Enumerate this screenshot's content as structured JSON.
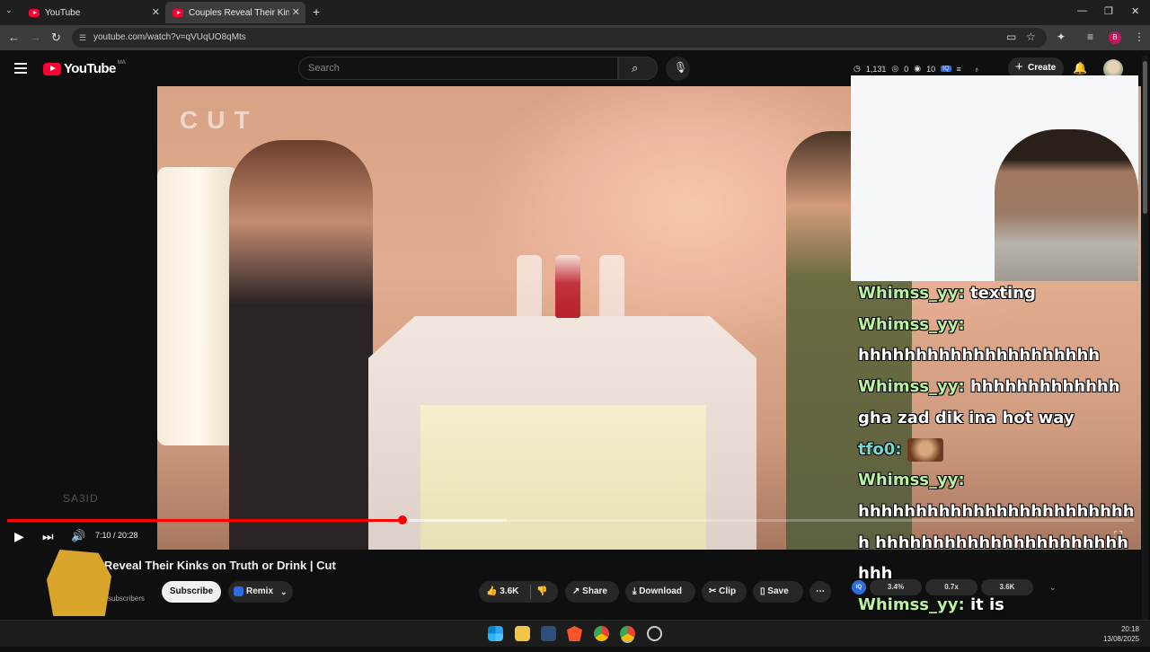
{
  "browser": {
    "tabs": [
      {
        "title": "YouTube",
        "active": false
      },
      {
        "title": "Couples Reveal Their Kinks on",
        "active": true
      }
    ],
    "url": "youtube.com/watch?v=qVUqUO8qMts",
    "profile_initial": "B"
  },
  "youtube": {
    "logo_text": "YouTube",
    "country_code": "MA",
    "search_placeholder": "Search",
    "header_stats": {
      "views": "1,131",
      "a": "0",
      "b": "10"
    },
    "create_label": "Create"
  },
  "video": {
    "brand_overlay": "CUT",
    "watermark": "SA3ID",
    "time": "7:10 / 20:28",
    "progress_fraction": 0.351
  },
  "chat": [
    {
      "user": "Whimss_yy:",
      "message": "texting",
      "color": "#b9f2a1"
    },
    {
      "user": "Whimss_yy:",
      "message": "hhhhhhhhhhhhhhhhhhhhh",
      "color": "#b9f2a1"
    },
    {
      "user": "Whimss_yy:",
      "message": "hhhhhhhhhhhhh gha zad dik ina hot way",
      "color": "#b9f2a1"
    },
    {
      "user": "tfo0:",
      "message": "",
      "color": "#77d8d2",
      "emote": true
    },
    {
      "user": "Whimss_yy:",
      "message": "hhhhhhhhhhhhhhhhhhhhhhhhh hhhhhhhhhhhhhhhhhhhhhhhhh",
      "color": "#b9f2a1"
    },
    {
      "user": "Whimss_yy:",
      "message": "it is hhhhhhhhhhhhhhhhhhhhhh",
      "color": "#b9f2a1"
    }
  ],
  "below": {
    "title": "Couples Reveal Their Kinks on Truth or Drink | Cut",
    "subscribers_label": "subscribers",
    "subscribe_label": "Subscribe",
    "remix_label": "Remix",
    "likes": "3.6K",
    "share_label": "Share",
    "download_label": "Download",
    "clip_label": "Clip",
    "save_label": "Save",
    "stats": [
      "3.4%",
      "0.7x",
      "3.6K"
    ]
  },
  "taskbar": {
    "time": "20:18",
    "date": "13/08/2025"
  }
}
